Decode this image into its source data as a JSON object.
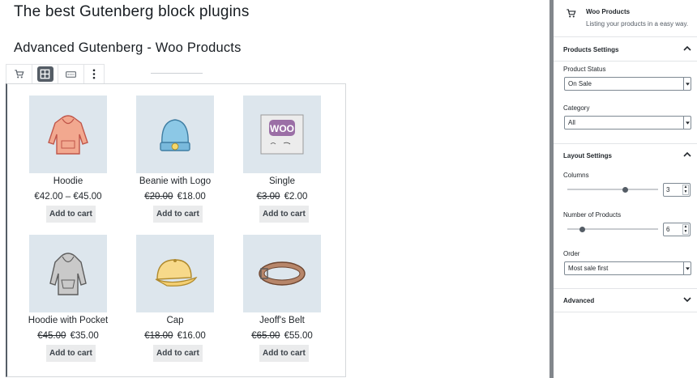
{
  "post": {
    "title": "The best Gutenberg block plugins",
    "heading": "Advanced Gutenberg - Woo Products"
  },
  "block_toolbar": {
    "buttons": [
      {
        "icon": "cart-icon",
        "active": false
      },
      {
        "icon": "grid-view-icon",
        "active": true
      },
      {
        "icon": "list-view-icon",
        "active": false
      },
      {
        "icon": "more-options-icon",
        "active": false
      }
    ]
  },
  "products": [
    {
      "name": "Hoodie",
      "price_text": "€42.00 – €45.00",
      "old_price": "",
      "price": "",
      "button": "Add to cart",
      "image": "hoodie-image"
    },
    {
      "name": "Beanie with Logo",
      "price_text": "",
      "old_price": "€20.00",
      "price": "€18.00",
      "button": "Add to cart",
      "image": "beanie-image"
    },
    {
      "name": "Single",
      "price_text": "",
      "old_price": "€3.00",
      "price": "€2.00",
      "button": "Add to cart",
      "image": "single-album-image"
    },
    {
      "name": "Hoodie with Pocket",
      "price_text": "",
      "old_price": "€45.00",
      "price": "€35.00",
      "button": "Add to cart",
      "image": "hoodie-pocket-image"
    },
    {
      "name": "Cap",
      "price_text": "",
      "old_price": "€18.00",
      "price": "€16.00",
      "button": "Add to cart",
      "image": "cap-image"
    },
    {
      "name": "Jeoff's Belt",
      "price_text": "",
      "old_price": "€65.00",
      "price": "€55.00",
      "button": "Add to cart",
      "image": "belt-image"
    }
  ],
  "sidebar": {
    "block": {
      "title": "Woo Products",
      "description": "Listing your products in a easy way.",
      "icon": "cart-icon"
    },
    "products_settings": {
      "label": "Products Settings",
      "status_label": "Product Status",
      "status_value": "On Sale",
      "category_label": "Category",
      "category_value": "All"
    },
    "layout_settings": {
      "label": "Layout Settings",
      "columns_label": "Columns",
      "columns_value": "3",
      "columns_fraction": 0.65,
      "number_label": "Number of Products",
      "number_value": "6",
      "number_fraction": 0.14,
      "order_label": "Order",
      "order_value": "Most sale first"
    },
    "advanced": {
      "label": "Advanced"
    }
  },
  "colors": {
    "thumb_bg": "#dde6ed",
    "button_bg": "#eaebec",
    "accent_dark": "#555d66",
    "sidebar_edge": "#82878c"
  }
}
